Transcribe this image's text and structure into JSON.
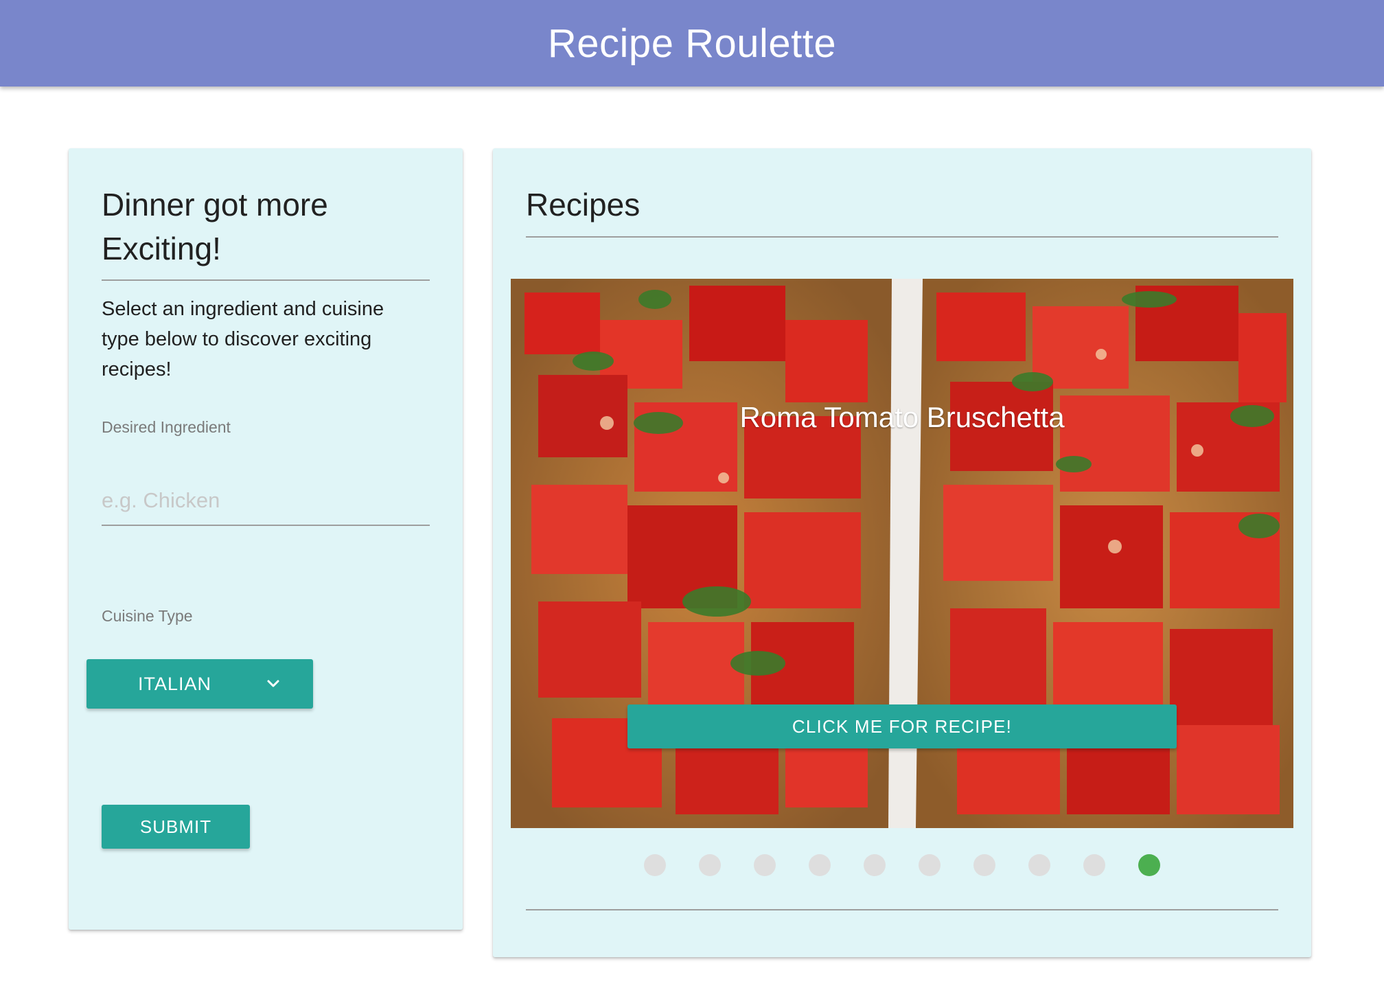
{
  "header": {
    "title": "Recipe Roulette"
  },
  "search_panel": {
    "title": "Dinner got more Exciting!",
    "description": "Select an ingredient and cuisine type below to discover exciting recipes!",
    "ingredient_label": "Desired Ingredient",
    "ingredient_placeholder": "e.g. Chicken",
    "ingredient_value": "",
    "cuisine_label": "Cuisine Type",
    "cuisine_selected": "ITALIAN",
    "submit_label": "SUBMIT"
  },
  "recipes_panel": {
    "title": "Recipes",
    "current_slide": {
      "title": "Roma Tomato Bruschetta",
      "button_label": "CLICK ME FOR RECIPE!"
    },
    "slide_count": 10,
    "active_index": 9
  },
  "colors": {
    "navbar": "#7986cb",
    "card_background": "#e0f5f7",
    "button": "#26a69a",
    "active_dot": "#4caf50",
    "inactive_dot": "#dedede"
  },
  "icons": {
    "select_arrow": "chevron-down-icon"
  }
}
